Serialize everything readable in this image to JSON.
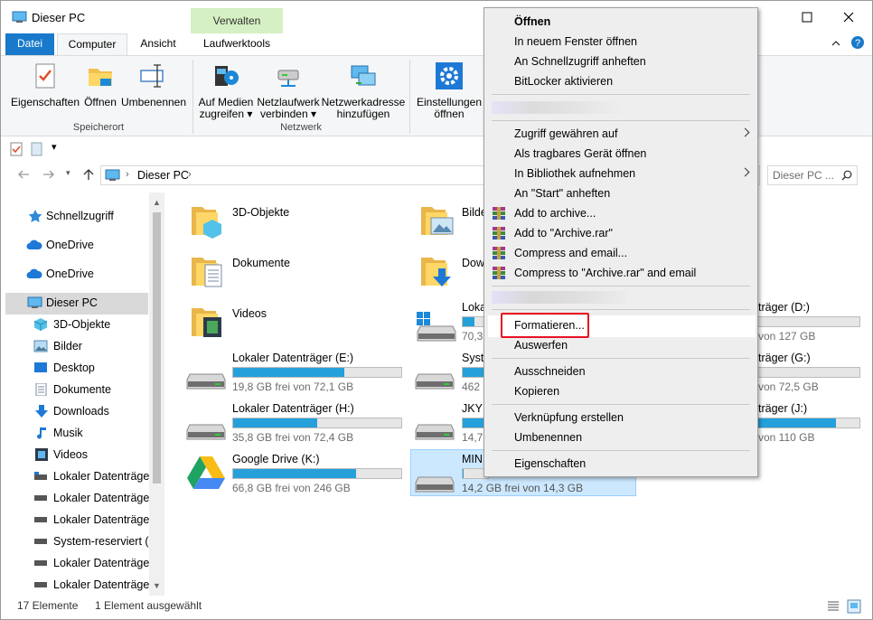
{
  "window": {
    "title": "Dieser PC"
  },
  "tabs": {
    "file": "Datei",
    "computer": "Computer",
    "view": "Ansicht",
    "manage_group": "Verwalten",
    "drive_tools": "Laufwerktools"
  },
  "ribbon": {
    "properties": "Eigenschaften",
    "open": "Öffnen",
    "rename": "Umbenennen",
    "location_group": "Speicherort",
    "media_line1": "Auf Medien",
    "media_line2": "zugreifen",
    "netdrive_line1": "Netzlaufwerk",
    "netdrive_line2": "verbinden",
    "netaddr_line1": "Netzwerkadresse",
    "netaddr_line2": "hinzufügen",
    "network_group": "Netzwerk",
    "settings_line1": "Einstellungen",
    "settings_line2": "öffnen"
  },
  "address": {
    "path": "Dieser PC",
    "search_placeholder": "Dieser PC ..."
  },
  "nav": {
    "quick": "Schnellzugriff",
    "onedrive1": "OneDrive",
    "onedrive2": "OneDrive",
    "thispc": "Dieser PC",
    "objects3d": "3D-Objekte",
    "pictures": "Bilder",
    "desktop": "Desktop",
    "documents": "Dokumente",
    "downloads": "Downloads",
    "music": "Musik",
    "videos": "Videos",
    "disk1": "Lokaler Datenträger",
    "disk2": "Lokaler Datenträger",
    "disk3": "Lokaler Datenträger",
    "sysres": "System-reserviert (F:",
    "disk4": "Lokaler Datenträger",
    "disk5": "Lokaler Datenträger"
  },
  "folders": {
    "objects3d": "3D-Objekte",
    "documents": "Dokumente",
    "videos": "Videos",
    "pictures_partial": "Bilde",
    "downloads_partial": "Dow"
  },
  "drives": {
    "e_name": "Lokaler Datenträger (E:)",
    "e_free": "19,8 GB frei von 72,1 GB",
    "e_fill": 0.66,
    "h_name": "Lokaler Datenträger (H:)",
    "h_free": "35,8 GB frei von 72,4 GB",
    "h_fill": 0.5,
    "k_name": "Google Drive (K:)",
    "k_free": "66,8 GB frei von 246 GB",
    "k_fill": 0.73,
    "c_name_partial": "Loka",
    "c_free_partial": "70,3",
    "c_fill": 0.45,
    "sys_name_partial": "Syst",
    "sys_free_partial": "462",
    "sys_fill": 0.45,
    "jky_name_partial": "JKY",
    "jky_free_partial": "14,7",
    "jky_fill": 0.45,
    "min_name_partial": "MIN",
    "min_free": "14,2 GB frei von 14,3 GB",
    "min_fill": 0.02,
    "d_name_partial": "träger (D:)",
    "d_free_partial": "von 127 GB",
    "d_fill": 0.0,
    "g_name_partial": "träger (G:)",
    "g_free_partial": "von 72,5 GB",
    "g_fill": 0.0,
    "j_name_partial": "träger (J:)",
    "j_free_partial": "von 110 GB",
    "j_fill": 0.77
  },
  "menu": {
    "open": "Öffnen",
    "open_new": "In neuem Fenster öffnen",
    "pin_quick": "An Schnellzugriff anheften",
    "bitlocker": "BitLocker aktivieren",
    "grant": "Zugriff gewähren auf",
    "portable": "Als tragbares Gerät öffnen",
    "library": "In Bibliothek aufnehmen",
    "pin_start": "An \"Start\" anheften",
    "add_archive": "Add to archive...",
    "add_rar": "Add to \"Archive.rar\"",
    "compress_email": "Compress and email...",
    "compress_rar_email": "Compress to \"Archive.rar\" and email",
    "format": "Formatieren...",
    "eject": "Auswerfen",
    "cut": "Ausschneiden",
    "copy": "Kopieren",
    "shortcut": "Verknüpfung erstellen",
    "rename": "Umbenennen",
    "properties": "Eigenschaften"
  },
  "status": {
    "count": "17 Elemente",
    "selected": "1 Element ausgewählt"
  },
  "colors": {
    "accent": "#1979ca",
    "highlight": "#cce8ff",
    "manage": "#d5f0c3",
    "format_box": "#e81123"
  }
}
